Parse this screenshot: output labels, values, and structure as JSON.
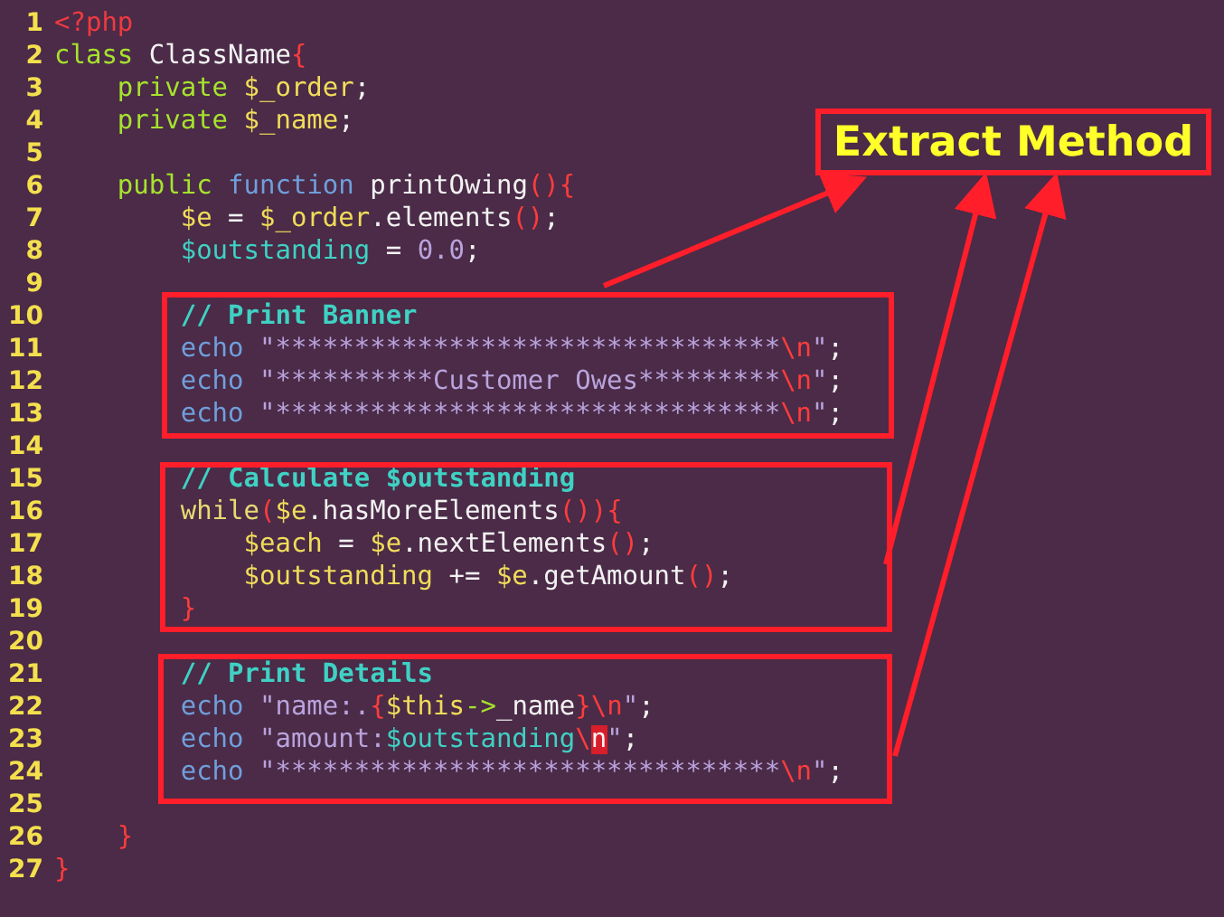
{
  "editor": {
    "lines": [
      {
        "number": "1",
        "tokens": [
          {
            "kind": "tag",
            "text": "<?php"
          }
        ]
      },
      {
        "number": "2",
        "tokens": [
          {
            "kind": "keyword",
            "text": "class"
          },
          {
            "kind": "name",
            "text": " ClassName"
          },
          {
            "kind": "brace",
            "text": "{"
          }
        ]
      },
      {
        "number": "3",
        "tokens": [
          {
            "kind": "keyword",
            "text": "    private"
          },
          {
            "kind": "variable",
            "text": " $_order"
          },
          {
            "kind": "punct",
            "text": ";"
          }
        ]
      },
      {
        "number": "4",
        "tokens": [
          {
            "kind": "keyword",
            "text": "    private"
          },
          {
            "kind": "variable",
            "text": " $_name"
          },
          {
            "kind": "punct",
            "text": ";"
          }
        ]
      },
      {
        "number": "5"
      },
      {
        "number": "6",
        "tokens": [
          {
            "kind": "keyword",
            "text": "    public"
          },
          {
            "kind": "storage",
            "text": " function"
          },
          {
            "kind": "name",
            "text": " printOwing"
          },
          {
            "kind": "brace",
            "text": "(){"
          }
        ]
      },
      {
        "number": "7",
        "tokens": [
          {
            "kind": "variable",
            "text": "        $e"
          },
          {
            "kind": "operator",
            "text": " = "
          },
          {
            "kind": "variable",
            "text": "$_order"
          },
          {
            "kind": "name",
            "text": ".elements"
          },
          {
            "kind": "brace",
            "text": "()"
          },
          {
            "kind": "punct",
            "text": ";"
          }
        ]
      },
      {
        "number": "8",
        "tokens": [
          {
            "kind": "property",
            "text": "        $outstanding"
          },
          {
            "kind": "operator",
            "text": " = "
          },
          {
            "kind": "number",
            "text": "0.0"
          },
          {
            "kind": "punct",
            "text": ";"
          }
        ]
      },
      {
        "number": "9"
      },
      {
        "number": "10",
        "tokens": [
          {
            "kind": "comment",
            "text": "        // Print Banner"
          }
        ]
      },
      {
        "number": "11",
        "tokens": [
          {
            "kind": "storage",
            "text": "        echo"
          },
          {
            "kind": "string",
            "text": " \"********************************"
          },
          {
            "kind": "escape",
            "text": "\\n"
          },
          {
            "kind": "string",
            "text": "\""
          },
          {
            "kind": "punct",
            "text": ";"
          }
        ]
      },
      {
        "number": "12",
        "tokens": [
          {
            "kind": "storage",
            "text": "        echo"
          },
          {
            "kind": "string",
            "text": " \"**********Customer Owes*********"
          },
          {
            "kind": "escape",
            "text": "\\n"
          },
          {
            "kind": "string",
            "text": "\""
          },
          {
            "kind": "punct",
            "text": ";"
          }
        ]
      },
      {
        "number": "13",
        "tokens": [
          {
            "kind": "storage",
            "text": "        echo"
          },
          {
            "kind": "string",
            "text": " \"********************************"
          },
          {
            "kind": "escape",
            "text": "\\n"
          },
          {
            "kind": "string",
            "text": "\""
          },
          {
            "kind": "punct",
            "text": ";"
          }
        ]
      },
      {
        "number": "14"
      },
      {
        "number": "15",
        "tokens": [
          {
            "kind": "comment",
            "text": "        // Calculate $outstanding"
          }
        ]
      },
      {
        "number": "16",
        "tokens": [
          {
            "kind": "control",
            "text": "        while"
          },
          {
            "kind": "brace",
            "text": "("
          },
          {
            "kind": "variable",
            "text": "$e"
          },
          {
            "kind": "name",
            "text": ".hasMoreElements"
          },
          {
            "kind": "brace",
            "text": "()){"
          }
        ]
      },
      {
        "number": "17",
        "tokens": [
          {
            "kind": "variable",
            "text": "            $each"
          },
          {
            "kind": "operator",
            "text": " = "
          },
          {
            "kind": "variable",
            "text": "$e"
          },
          {
            "kind": "name",
            "text": ".nextElements"
          },
          {
            "kind": "brace",
            "text": "()"
          },
          {
            "kind": "punct",
            "text": ";"
          }
        ]
      },
      {
        "number": "18",
        "tokens": [
          {
            "kind": "variable",
            "text": "            $outstanding"
          },
          {
            "kind": "operator",
            "text": " += "
          },
          {
            "kind": "variable",
            "text": "$e"
          },
          {
            "kind": "name",
            "text": ".getAmount"
          },
          {
            "kind": "brace",
            "text": "()"
          },
          {
            "kind": "punct",
            "text": ";"
          }
        ]
      },
      {
        "number": "19",
        "tokens": [
          {
            "kind": "brace",
            "text": "        }"
          }
        ]
      },
      {
        "number": "20"
      },
      {
        "number": "21",
        "tokens": [
          {
            "kind": "comment",
            "text": "        // Print Details"
          }
        ]
      },
      {
        "number": "22",
        "tokens": [
          {
            "kind": "storage",
            "text": "        echo"
          },
          {
            "kind": "string",
            "text": " \"name:."
          },
          {
            "kind": "brace",
            "text": "{"
          },
          {
            "kind": "variable",
            "text": "$this"
          },
          {
            "kind": "keyword",
            "text": "->"
          },
          {
            "kind": "name",
            "text": "_name"
          },
          {
            "kind": "brace",
            "text": "}"
          },
          {
            "kind": "escape",
            "text": "\\n"
          },
          {
            "kind": "string",
            "text": "\""
          },
          {
            "kind": "punct",
            "text": ";"
          }
        ]
      },
      {
        "number": "23",
        "tokens": [
          {
            "kind": "storage",
            "text": "        echo"
          },
          {
            "kind": "string",
            "text": " \"amount:"
          },
          {
            "kind": "property",
            "text": "$outstanding"
          },
          {
            "kind": "escape",
            "text": "\\"
          },
          {
            "kind": "cursor",
            "text": "n"
          },
          {
            "kind": "string",
            "text": "\""
          },
          {
            "kind": "punct",
            "text": ";"
          }
        ]
      },
      {
        "number": "24",
        "tokens": [
          {
            "kind": "storage",
            "text": "        echo"
          },
          {
            "kind": "string",
            "text": " \"********************************"
          },
          {
            "kind": "escape",
            "text": "\\n"
          },
          {
            "kind": "string",
            "text": "\""
          },
          {
            "kind": "punct",
            "text": ";"
          }
        ]
      },
      {
        "number": "25"
      },
      {
        "number": "26",
        "tokens": [
          {
            "kind": "brace",
            "text": "    }"
          }
        ]
      },
      {
        "number": "27",
        "tokens": [
          {
            "kind": "brace",
            "text": "}"
          }
        ]
      }
    ]
  },
  "annotation": {
    "label": "Extract Method"
  }
}
